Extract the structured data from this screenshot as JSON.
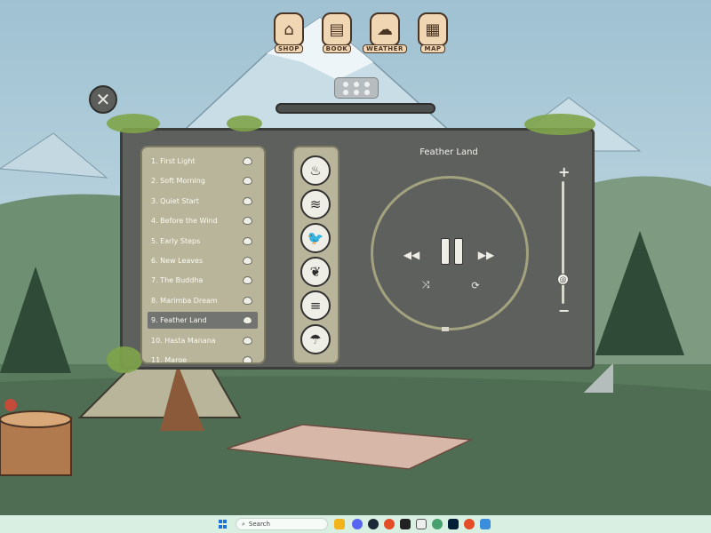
{
  "top_menu": [
    {
      "label": "SHOP",
      "icon": "mushroom-house-icon"
    },
    {
      "label": "BOOK",
      "icon": "book-icon"
    },
    {
      "label": "WEATHER",
      "icon": "weather-cloud-icon"
    },
    {
      "label": "MAP",
      "icon": "map-icon"
    }
  ],
  "close_label": "✕",
  "player": {
    "now_playing": "Feather Land",
    "tracks": [
      "1. First Light",
      "2. Soft Morning",
      "3. Quiet Start",
      "4. Before the Wind",
      "5. Early Steps",
      "6. New Leaves",
      "7. The Buddha",
      "8. Marimba Dream",
      "9. Feather Land",
      "10. Hasta Manana",
      "11. Marge"
    ],
    "active_track_index": 8,
    "volume_plus": "+",
    "volume_minus": "−",
    "volume_level": 0.2
  },
  "sounds": [
    {
      "icon": "fire-icon",
      "glyph": "♨"
    },
    {
      "icon": "water-waves-icon",
      "glyph": "≋"
    },
    {
      "icon": "bird-icon",
      "glyph": "🐦"
    },
    {
      "icon": "leaf-icon",
      "glyph": "❦"
    },
    {
      "icon": "wind-icon",
      "glyph": "≡"
    },
    {
      "icon": "rain-cloud-icon",
      "glyph": "☂"
    }
  ],
  "taskbar": {
    "search_placeholder": "Search"
  },
  "colors": {
    "panel": "#5d605d",
    "list_bg": "#b8b59b",
    "active_row": "#727471",
    "taskbar": "#d9efe1"
  }
}
